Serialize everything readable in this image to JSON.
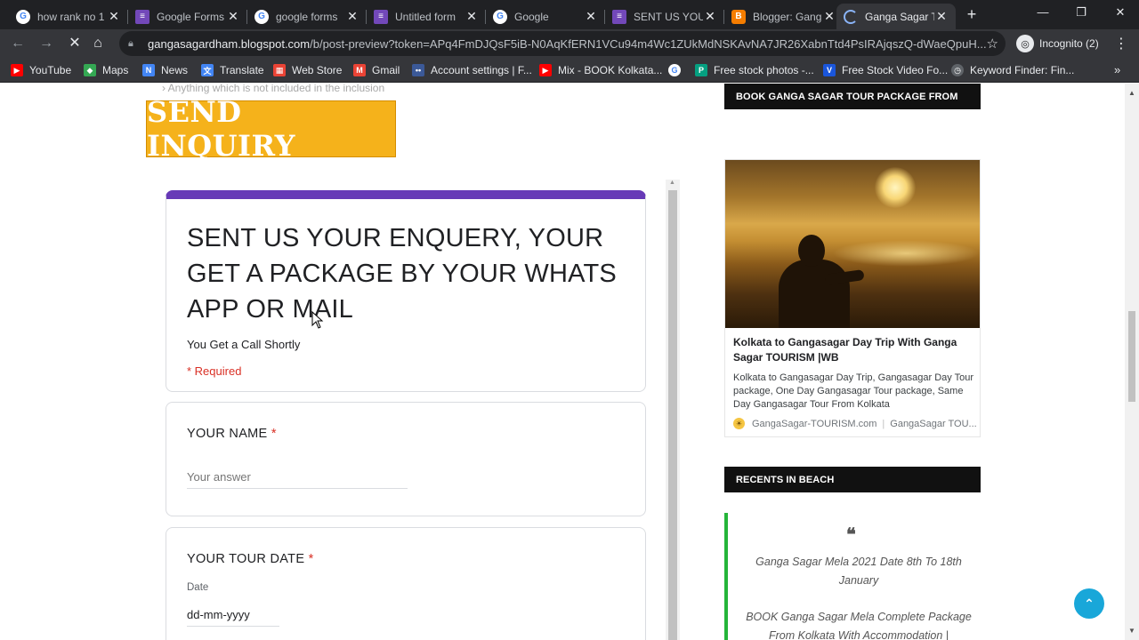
{
  "browser": {
    "tabs": [
      {
        "title": "how rank no 1",
        "icon": "google-icon"
      },
      {
        "title": "Google Forms",
        "icon": "google-forms-icon"
      },
      {
        "title": "google forms",
        "icon": "google-icon"
      },
      {
        "title": "Untitled form",
        "icon": "google-forms-icon"
      },
      {
        "title": "Google",
        "icon": "google-icon"
      },
      {
        "title": "SENT US YOUR",
        "icon": "google-forms-icon"
      },
      {
        "title": "Blogger: Gang",
        "icon": "blogger-icon"
      },
      {
        "title": "Ganga Sagar T",
        "icon": "loading-icon",
        "active": true
      }
    ],
    "close_glyph": "✕",
    "new_tab_glyph": "+",
    "window_controls": {
      "minimize": "—",
      "restore": "❐",
      "close": "✕"
    },
    "url_host": "gangasagardham.blogspot.com",
    "url_path": "/b/post-preview?token=APq4FmDJQsF5iB-N0AqKfERN1VCu94m4Wc1ZUkMdNSKAvNA7JR26XabnTtd4PsIRAjqszQ-dWaeQpuH...",
    "incognito_label": "Incognito (2)",
    "bookmarks": [
      {
        "label": "YouTube",
        "color": "#ff0000"
      },
      {
        "label": "Maps",
        "color": "#34a853"
      },
      {
        "label": "News",
        "color": "#4285f4"
      },
      {
        "label": "Translate",
        "color": "#4285f4"
      },
      {
        "label": "Web Store",
        "color": "#ea4335"
      },
      {
        "label": "Gmail",
        "color": "#ea4335"
      },
      {
        "label": "Account settings | F...",
        "color": "#3b5998"
      },
      {
        "label": "Mix - BOOK Kolkata...",
        "color": "#ff0000"
      },
      {
        "label": "",
        "color": "#ffffff"
      },
      {
        "label": "Free stock photos -...",
        "color": "#05a081"
      },
      {
        "label": "Free Stock Video Fo...",
        "color": "#1a56db"
      },
      {
        "label": "Keyword Finder: Fin...",
        "color": "#5f6368"
      }
    ],
    "bookmarks_more": "»"
  },
  "page": {
    "faded_line": "› Anything which is not included in the inclusion",
    "inquiry_banner": "SEND INQUIRY",
    "form": {
      "title": "SENT US YOUR ENQUERY, YOUR GET A PACKAGE BY YOUR WHATS APP OR MAIL",
      "description": "You Get a Call Shortly",
      "required_note": "* Required",
      "q1_label": "YOUR NAME",
      "q1_placeholder": "Your answer",
      "q2_label": "YOUR TOUR DATE",
      "q2_sub": "Date",
      "q2_value": "dd-mm-yyyy",
      "required_star": "*",
      "accent_color": "#673ab7"
    },
    "sidebar": {
      "header1": "BOOK GANGA SAGAR TOUR PACKAGE FROM",
      "ad_title": "Kolkata to Gangasagar Day Trip With Ganga Sagar TOURISM |WB",
      "ad_text": "Kolkata to Gangasagar Day Trip, Gangasagar Day Tour package, One Day Gangasagar Tour package, Same Day Gangasagar Tour From Kolkata",
      "ad_source": "GangaSagar-TOURISM.com",
      "ad_source2": "GangaSagar TOU...",
      "header2": "RECENTS IN BEACH",
      "quote_glyph": "❝",
      "recent1": "Ganga Sagar Mela 2021 Date 8th To 18th January",
      "recent2": "BOOK Ganga Sagar Mela Complete Package From Kolkata With Accommodation |"
    },
    "scroll_top_glyph": "⌃"
  }
}
